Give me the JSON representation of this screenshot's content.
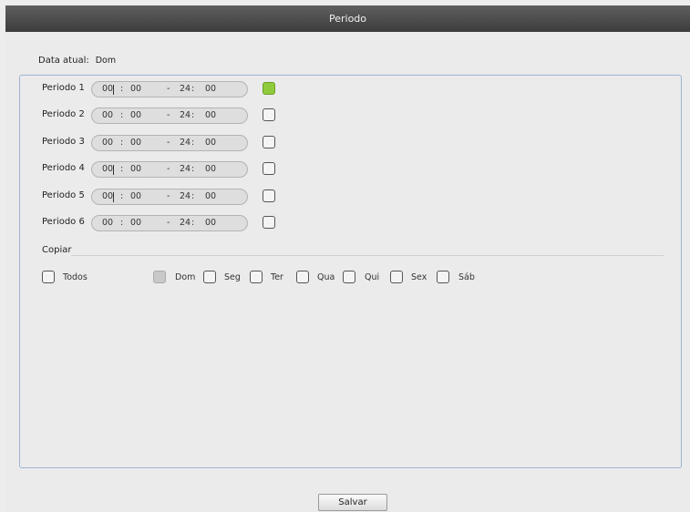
{
  "window": {
    "title": "Periodo"
  },
  "current_date": {
    "label": "Data atual:",
    "value": "Dom"
  },
  "periods": [
    {
      "label": "Periodo 1",
      "start_h": "00",
      "start_m": "00",
      "end_h": "24",
      "end_m": "00",
      "enabled": true
    },
    {
      "label": "Periodo 2",
      "start_h": "00",
      "start_m": "00",
      "end_h": "24",
      "end_m": "00",
      "enabled": false
    },
    {
      "label": "Periodo 3",
      "start_h": "00",
      "start_m": "00",
      "end_h": "24",
      "end_m": "00",
      "enabled": false
    },
    {
      "label": "Periodo 4",
      "start_h": "00",
      "start_m": "00",
      "end_h": "24",
      "end_m": "00",
      "enabled": false
    },
    {
      "label": "Periodo 5",
      "start_h": "00",
      "start_m": "00",
      "end_h": "24",
      "end_m": "00",
      "enabled": false
    },
    {
      "label": "Periodo 6",
      "start_h": "00",
      "start_m": "00",
      "end_h": "24",
      "end_m": "00",
      "enabled": false
    }
  ],
  "separators": {
    "colon": ":",
    "dash": "-"
  },
  "copy": {
    "label": "Copiar",
    "all_label": "Todos",
    "days": [
      "Dom",
      "Seg",
      "Ter",
      "Qua",
      "Qui",
      "Sex",
      "Sáb"
    ]
  },
  "save_label": "Salvar",
  "colors": {
    "enabled_check": "#8fcb3c",
    "panel_border": "#9cb4d4",
    "titlebar": "#4a4a4a"
  }
}
